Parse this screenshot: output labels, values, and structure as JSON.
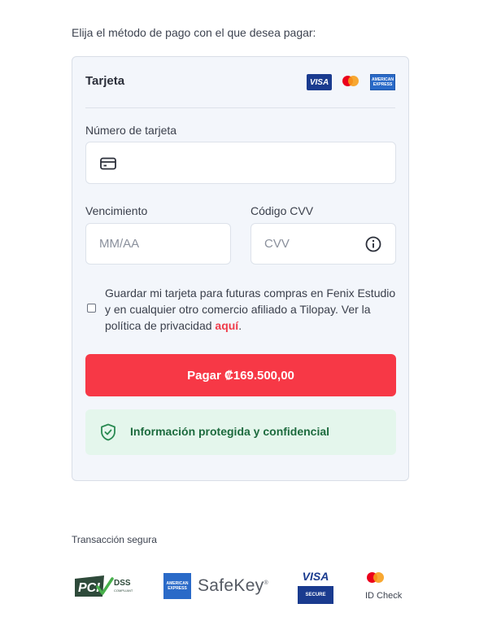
{
  "intro": "Elija el método de pago con el que desea pagar:",
  "card": {
    "title": "Tarjeta",
    "logos": {
      "visa": "VISA",
      "mastercard": "mastercard-logo",
      "amex": "AMERICAN EXPRESS"
    },
    "card_number_label": "Número de tarjeta",
    "card_number_value": "",
    "expiry_label": "Vencimiento",
    "expiry_placeholder": "MM/AA",
    "cvv_label": "Código CVV",
    "cvv_placeholder": "CVV",
    "save_text": "Guardar mi tarjeta para futuras compras en Fenix Estudio y en cualquier otro comercio afiliado a Tilopay. Ver la política de privacidad ",
    "save_link": "aquí",
    "save_suffix": ".",
    "save_checked": false,
    "pay_button": "Pagar ₡169.500,00",
    "secure_message": "Información protegida y confidencial"
  },
  "footer": {
    "transaction_label": "Transacción segura",
    "badges": {
      "pci": "PCI DSS",
      "amex_box": "AMERICAN EXPRESS",
      "safekey": "SafeKey",
      "visa_top": "VISA",
      "visa_bottom": "SECURE",
      "idcheck": "ID Check"
    }
  },
  "colors": {
    "pay_button": "#f73846",
    "link": "#ef3b4a",
    "secure_bg": "#e4f6ec",
    "secure_text": "#1d6b3e",
    "visa_blue": "#1a3b8f",
    "amex_blue": "#2a6ac8"
  },
  "icons": [
    "credit-card-icon",
    "info-icon",
    "shield-check-icon"
  ]
}
